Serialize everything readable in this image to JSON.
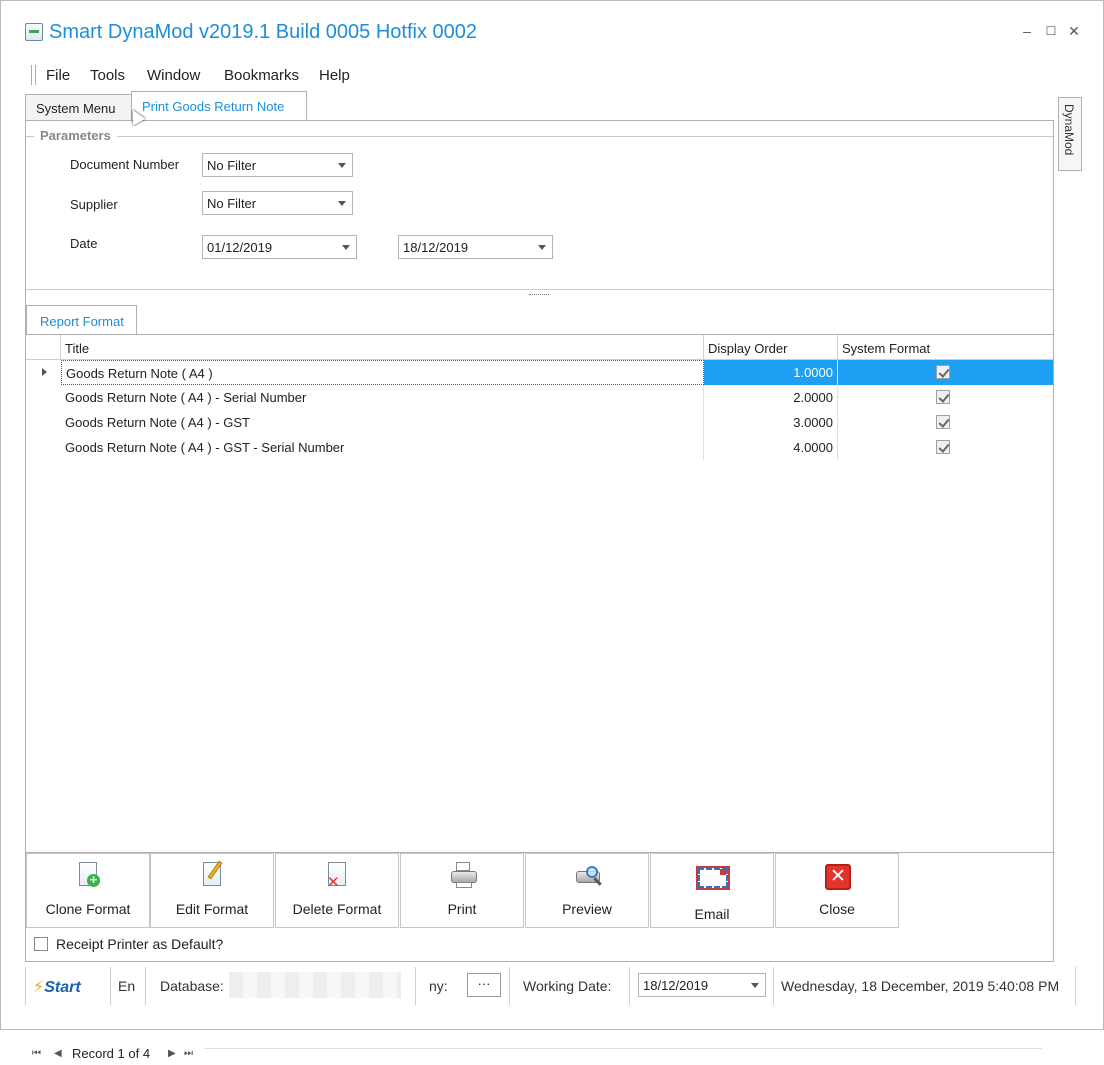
{
  "window": {
    "title": "Smart DynaMod v2019.1 Build 0005 Hotfix 0002",
    "minimize": "–",
    "maximize": "☐",
    "close": "✕"
  },
  "menu": [
    "File",
    "Tools",
    "Window",
    "Bookmarks",
    "Help"
  ],
  "tabs": [
    "System Menu",
    "Print Goods Return Note"
  ],
  "side_tab": "DynaMod",
  "parameters": {
    "title": "Parameters",
    "document_number_label": "Document Number",
    "document_number_value": "No Filter",
    "supplier_label": "Supplier",
    "supplier_value": "No Filter",
    "date_label": "Date",
    "date_from": "01/12/2019",
    "date_to": "18/12/2019"
  },
  "report_format": {
    "tab_label": "Report Format",
    "columns": [
      "Title",
      "Display Order",
      "System Format"
    ],
    "rows": [
      {
        "title": "Goods Return Note ( A4 )",
        "order": "1.0000",
        "system": true
      },
      {
        "title": "Goods Return Note ( A4 ) - Serial Number",
        "order": "2.0000",
        "system": true
      },
      {
        "title": "Goods Return Note ( A4 ) - GST",
        "order": "3.0000",
        "system": true
      },
      {
        "title": "Goods Return Note ( A4 ) - GST - Serial Number",
        "order": "4.0000",
        "system": true
      }
    ],
    "record_text": "Record 1 of 4"
  },
  "toolbar": [
    "Clone Format",
    "Edit Format",
    "Delete Format",
    "Print",
    "Preview",
    "Email",
    "Close"
  ],
  "receipt_default_label": "Receipt Printer as Default?",
  "status": {
    "logo": "Start",
    "env": "En",
    "database_label": "Database:",
    "company_label": "ny:",
    "ellipsis": "···",
    "working_date_label": "Working Date:",
    "working_date_value": "18/12/2019",
    "datetime": "Wednesday, 18 December, 2019 5:40:08 PM"
  },
  "colors": {
    "accent": "#1c8fd8",
    "selection": "#1e9ff2",
    "close_red": "#e2342b"
  }
}
